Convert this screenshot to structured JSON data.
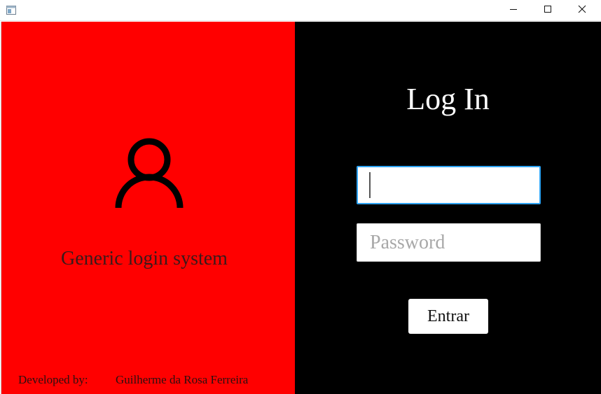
{
  "window": {
    "app_icon": "app-window-icon",
    "controls": [
      "minimize-icon",
      "maximize-icon",
      "close-icon"
    ]
  },
  "left_panel": {
    "background": "#ff0000",
    "icon": "user-icon",
    "subtitle": "Generic login system",
    "footer_label": "Developed by:",
    "footer_name": "Guilherme da Rosa Ferreira"
  },
  "right_panel": {
    "background": "#000000",
    "heading": "Log In",
    "username": {
      "value": "",
      "placeholder": ""
    },
    "password": {
      "value": "",
      "placeholder": "Password"
    },
    "submit_label": "Entrar"
  },
  "colors": {
    "focus_border": "#2ea3f2",
    "placeholder": "#a8a8a8"
  }
}
